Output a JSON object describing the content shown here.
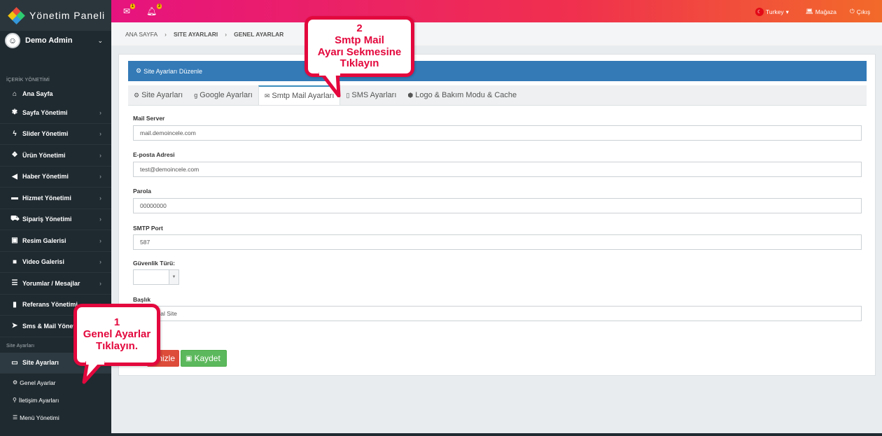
{
  "sidebar": {
    "brand_title": "Yönetim Paneli",
    "user_name": "Demo Admin",
    "section_content": "İÇERİK YÖNETİMİ",
    "items": [
      {
        "label": "Ana Sayfa",
        "icon": "home-icon"
      },
      {
        "label": "Sayfa Yönetimi",
        "icon": "pages-icon"
      },
      {
        "label": "Slider Yönetimi",
        "icon": "bolt-icon"
      },
      {
        "label": "Ürün Yönetimi",
        "icon": "cubes-icon"
      },
      {
        "label": "Haber Yönetimi",
        "icon": "bullhorn-icon"
      },
      {
        "label": "Hizmet Yönetimi",
        "icon": "briefcase-icon"
      },
      {
        "label": "Sipariş Yönetimi",
        "icon": "cart-icon"
      },
      {
        "label": "Resim Galerisi",
        "icon": "image-icon"
      },
      {
        "label": "Video Galerisi",
        "icon": "video-icon"
      },
      {
        "label": "Yorumlar / Mesajlar",
        "icon": "list-icon"
      },
      {
        "label": "Referans Yönetimi",
        "icon": "bookmark-icon"
      },
      {
        "label": "Sms & Mail Yönetimi",
        "icon": "send-icon"
      }
    ],
    "section_site": "Site Ayarları",
    "site_settings_label": "Site Ayarları",
    "sub_items": [
      {
        "label": "Genel Ayarlar",
        "icon": "cogs-icon"
      },
      {
        "label": "İletişim Ayarları",
        "icon": "map-marker-icon"
      },
      {
        "label": "Menü  Yönetimi",
        "icon": "list-icon"
      }
    ]
  },
  "topbar": {
    "mail_badge": "1",
    "bell_badge": "3",
    "language": "Turkey",
    "store": "Mağaza",
    "logout": "Çıkış"
  },
  "breadcrumb": {
    "home": "ANA SAYFA",
    "section": "SITE AYARLARI",
    "current": "GENEL AYARLAR"
  },
  "card": {
    "header": "Site Ayarları Düzenle",
    "tabs": [
      {
        "label": "Site Ayarları",
        "icon": "gear-icon"
      },
      {
        "label": "Google Ayarları",
        "icon": "google-icon"
      },
      {
        "label": "Smtp Mail Ayarları",
        "icon": "envelope-icon",
        "active": true
      },
      {
        "label": "SMS Ayarları",
        "icon": "mobile-icon"
      },
      {
        "label": "Logo & Bakım Modu & Cache",
        "icon": "cube-icon"
      }
    ]
  },
  "form": {
    "mail_server_label": "Mail Server",
    "mail_server_value": "mail.demoincele.com",
    "email_label": "E-posta Adresi",
    "email_value": "test@demoincele.com",
    "password_label": "Parola",
    "password_value": "00000000",
    "smtp_port_label": "SMTP Port",
    "smtp_port_value": "587",
    "security_label": "Güvenlik Türü:",
    "security_value": "",
    "title_label": "Başlık",
    "title_value": "Kurumsal Site"
  },
  "buttons": {
    "preview": "Önizle",
    "save": "Kaydet"
  },
  "callouts": {
    "one_number": "1",
    "one_text": "Genel Ayarlar\nTıklayın.",
    "two_number": "2",
    "two_text": "Smtp Mail\nAyarı Sekmesine\nTıklayın"
  }
}
